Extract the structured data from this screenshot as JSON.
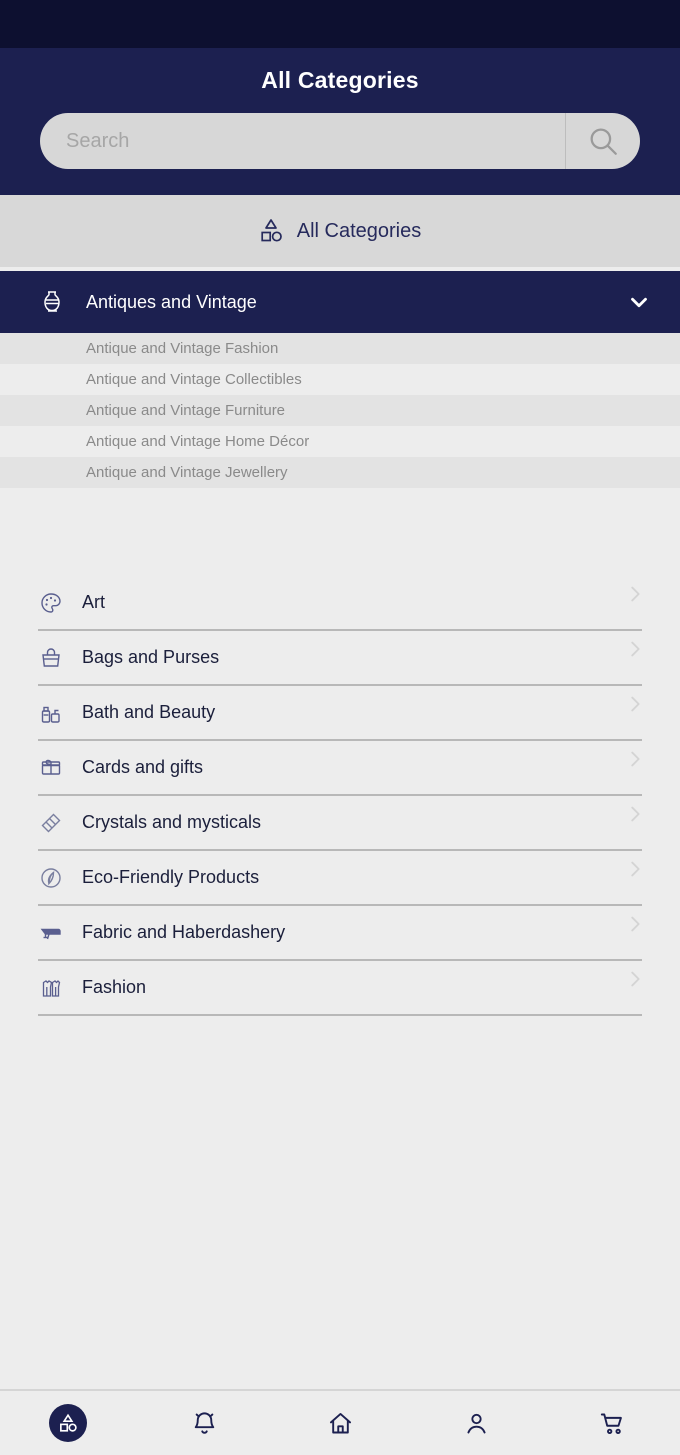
{
  "header": {
    "title": "All Categories",
    "search": {
      "value": "",
      "placeholder": "Search",
      "icon": "search-icon"
    }
  },
  "breadcrumb": {
    "label": "All Categories",
    "icon": "categories-icon"
  },
  "expanded_category": {
    "label": "Antiques and Vintage",
    "icon": "vase-icon",
    "chevron": "chevron-down-icon",
    "subitems": [
      {
        "label": "Antique and Vintage Fashion"
      },
      {
        "label": "Antique and Vintage Collectibles"
      },
      {
        "label": "Antique and Vintage Furniture"
      },
      {
        "label": "Antique and Vintage Home Décor"
      },
      {
        "label": "Antique and Vintage Jewellery"
      }
    ]
  },
  "categories": [
    {
      "label": "Art",
      "icon": "palette-icon"
    },
    {
      "label": "Bags and Purses",
      "icon": "handbag-icon"
    },
    {
      "label": "Bath and Beauty",
      "icon": "soap-bottle-icon"
    },
    {
      "label": "Cards and gifts",
      "icon": "gift-box-icon"
    },
    {
      "label": "Crystals and mysticals",
      "icon": "crystal-icon"
    },
    {
      "label": "Eco-Friendly Products",
      "icon": "leaf-icon"
    },
    {
      "label": "Fabric and Haberdashery",
      "icon": "sewing-machine-icon"
    },
    {
      "label": "Fashion",
      "icon": "clothing-icon"
    }
  ],
  "bottom_nav": [
    {
      "name": "categories",
      "icon": "categories-icon",
      "active": true
    },
    {
      "name": "notifications",
      "icon": "bell-icon",
      "active": false
    },
    {
      "name": "home",
      "icon": "home-icon",
      "active": false
    },
    {
      "name": "account",
      "icon": "person-icon",
      "active": false
    },
    {
      "name": "cart",
      "icon": "cart-icon",
      "active": false
    }
  ],
  "colors": {
    "brand_navy": "#1c2050",
    "status_bar": "#0d1030",
    "page_bg": "#ededed",
    "breadcrumb_bg": "#d8d8d8",
    "search_bg": "#d7d7d7",
    "subitem_text": "#8a8a8a",
    "divider": "#b8b8b8"
  }
}
